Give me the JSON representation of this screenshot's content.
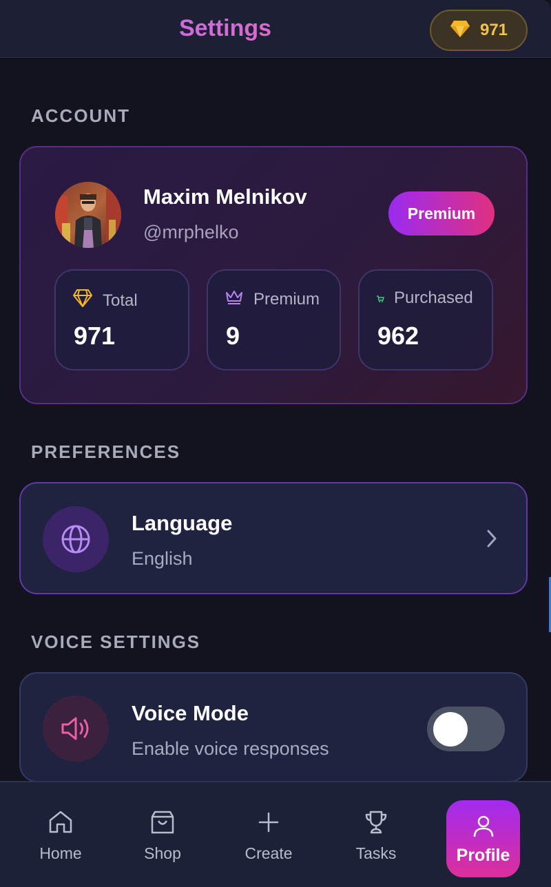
{
  "header": {
    "title": "Settings",
    "gem_count": "971"
  },
  "sections": {
    "account": "ACCOUNT",
    "preferences": "PREFERENCES",
    "voice": "VOICE SETTINGS"
  },
  "account": {
    "name": "Maxim Melnikov",
    "handle": "@mrphelko",
    "badge": "Premium",
    "stats": [
      {
        "label": "Total",
        "value": "971",
        "icon": "diamond-icon"
      },
      {
        "label": "Premium",
        "value": "9",
        "icon": "crown-icon"
      },
      {
        "label": "Purchased",
        "value": "962",
        "icon": "cart-icon"
      }
    ]
  },
  "preferences": {
    "language_title": "Language",
    "language_value": "English"
  },
  "voice": {
    "title": "Voice Mode",
    "subtitle": "Enable voice responses",
    "enabled": false
  },
  "nav": [
    {
      "label": "Home",
      "icon": "home-icon"
    },
    {
      "label": "Shop",
      "icon": "shopping-bag-icon"
    },
    {
      "label": "Create",
      "icon": "plus-icon"
    },
    {
      "label": "Tasks",
      "icon": "trophy-icon"
    },
    {
      "label": "Profile",
      "icon": "user-icon",
      "active": true
    }
  ],
  "colors": {
    "accent_purple": "#9b2bf0",
    "accent_pink": "#e0307f",
    "gem_gold": "#f4c24a",
    "background": "#12131f"
  }
}
